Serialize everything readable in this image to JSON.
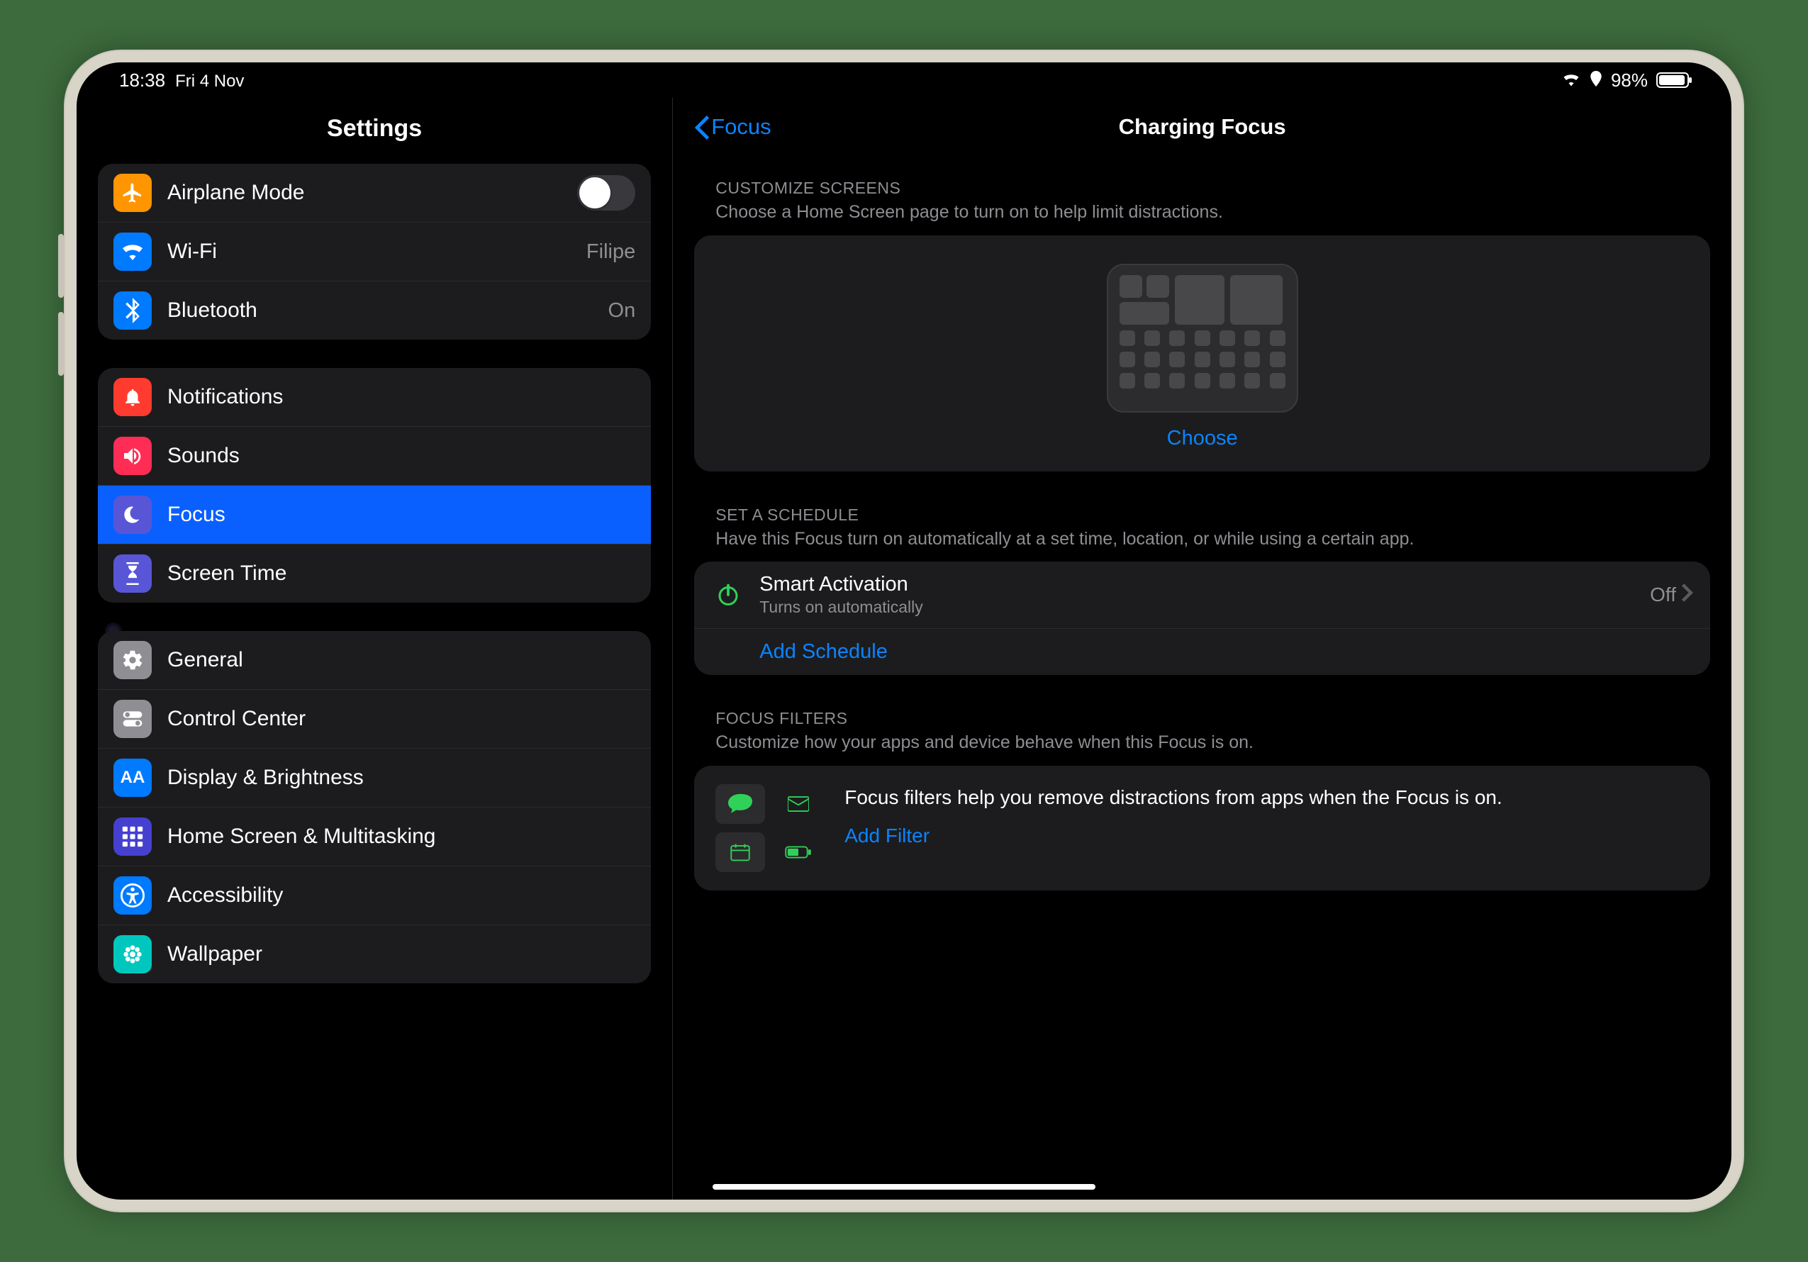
{
  "status": {
    "time": "18:38",
    "date": "Fri 4 Nov",
    "battery": "98%"
  },
  "sidebar": {
    "title": "Settings",
    "group1": {
      "airplane": "Airplane Mode",
      "wifi": "Wi-Fi",
      "wifi_value": "Filipe",
      "bluetooth": "Bluetooth",
      "bluetooth_value": "On"
    },
    "group2": {
      "notifications": "Notifications",
      "sounds": "Sounds",
      "focus": "Focus",
      "screentime": "Screen Time"
    },
    "group3": {
      "general": "General",
      "control": "Control Center",
      "display": "Display & Brightness",
      "home": "Home Screen & Multitasking",
      "accessibility": "Accessibility",
      "wallpaper": "Wallpaper"
    }
  },
  "detail": {
    "back": "Focus",
    "title": "Charging Focus",
    "customize": {
      "label": "Customize Screens",
      "sub": "Choose a Home Screen page to turn on to help limit distractions.",
      "choose": "Choose"
    },
    "schedule": {
      "label": "Set a Schedule",
      "sub": "Have this Focus turn on automatically at a set time, location, or while using a certain app.",
      "smart_title": "Smart Activation",
      "smart_sub": "Turns on automatically",
      "smart_value": "Off",
      "add": "Add Schedule"
    },
    "filters": {
      "label": "Focus Filters",
      "sub": "Customize how your apps and device behave when this Focus is on.",
      "desc": "Focus filters help you remove distractions from apps when the Focus is on.",
      "add": "Add Filter"
    }
  }
}
